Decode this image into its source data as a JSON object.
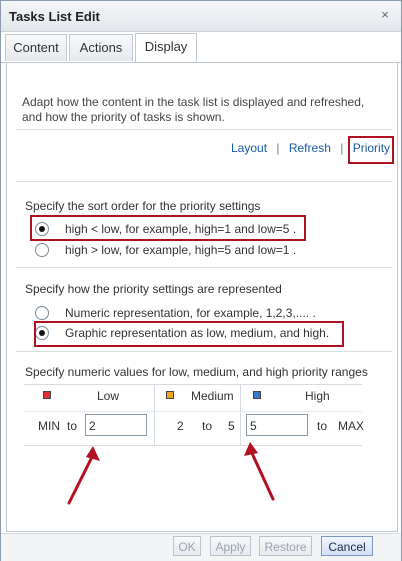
{
  "dialog": {
    "title": "Tasks List Edit",
    "close_glyph": "×"
  },
  "tabs": [
    {
      "label": "Content",
      "active": false
    },
    {
      "label": "Actions",
      "active": false
    },
    {
      "label": "Display",
      "active": true
    }
  ],
  "display": {
    "description": "Adapt how the content in the task list is displayed and refreshed, and how the priority of tasks is shown.",
    "links": [
      "Layout",
      "Refresh",
      "Priority"
    ],
    "link_separator": "|",
    "sort_section_label": "Specify the sort order for the priority settings",
    "sort_options": [
      {
        "label": "high < low, for example, high=1 and low=5 .",
        "selected": true
      },
      {
        "label": "high > low, for example, high=5 and low=1 .",
        "selected": false
      }
    ],
    "representation_section_label": "Specify how the priority settings are represented",
    "representation_options": [
      {
        "label": "Numeric representation, for example, 1,2,3,.... .",
        "selected": false
      },
      {
        "label": "Graphic representation as low, medium, and high.",
        "selected": true
      }
    ],
    "ranges_section_label": "Specify numeric values for low, medium, and high priority ranges",
    "ranges": {
      "headers": {
        "low": "Low",
        "medium": "Medium",
        "high": "High"
      },
      "min_label": "MIN",
      "to_word": "to",
      "max_label": "MAX",
      "low_to_value": "2",
      "medium_from": "2",
      "medium_to": "5",
      "high_from_value": "5"
    },
    "colors": {
      "low_icon": "#e0303a",
      "medium_icon": "#f0a020",
      "high_icon": "#3a78d0",
      "highlight_box": "#b01020",
      "arrow": "#b01020"
    }
  },
  "footer": {
    "buttons": [
      "OK",
      "Apply",
      "Restore",
      "Cancel"
    ]
  }
}
